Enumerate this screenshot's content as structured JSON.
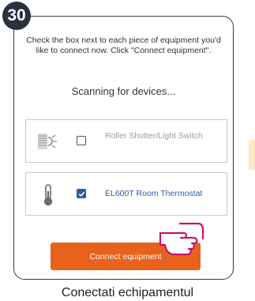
{
  "step": {
    "number": "30"
  },
  "screen": {
    "instructions": "Check the box next to each piece of equipment you'd like to connect now. Click \"Connect equipment\".",
    "scanning_text": "Scanning for devices...",
    "devices": [
      {
        "name": "Roller Shutter/Light Switch",
        "checked": false,
        "icon": "roller-shutter-light-icon"
      },
      {
        "name": "EL600T Room Thermostat",
        "checked": true,
        "icon": "thermostat-icon"
      }
    ],
    "connect_button_label": "Connect equipment"
  },
  "caption": "Conectati echipamentul",
  "colors": {
    "accent": "#e8621c",
    "checkbox_checked": "#2f5aa8",
    "badge": "#2b2f3f",
    "side_tab": "#fde9c2"
  }
}
